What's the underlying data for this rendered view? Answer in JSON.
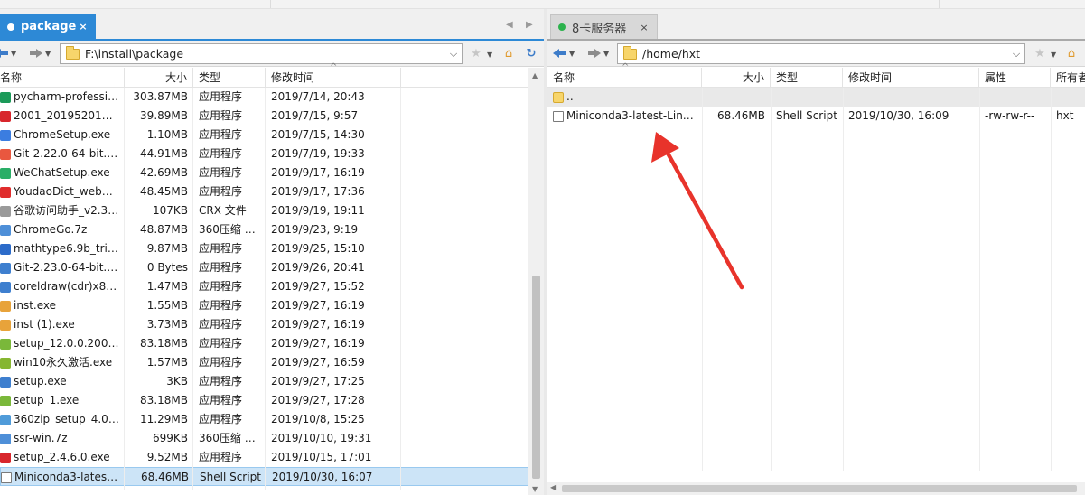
{
  "left_pane": {
    "tab": {
      "label": "package",
      "close": "×"
    },
    "address": {
      "path": "F:\\install\\package",
      "dropdown": "⌵"
    },
    "columns": [
      "名称",
      "大小",
      "类型",
      "修改时间"
    ],
    "files": [
      {
        "name": "pycharm-professio...",
        "size": "303.87MB",
        "type": "应用程序",
        "modified": "2019/7/14, 20:43",
        "icon": "pycharm-icon",
        "color": "#1b9a59"
      },
      {
        "name": "2001_20195201930...",
        "size": "39.89MB",
        "type": "应用程序",
        "modified": "2019/7/15, 9:57",
        "icon": "app-icon",
        "color": "#d8262c"
      },
      {
        "name": "ChromeSetup.exe",
        "size": "1.10MB",
        "type": "应用程序",
        "modified": "2019/7/15, 14:30",
        "icon": "chrome-icon",
        "color": "#3b7de0"
      },
      {
        "name": "Git-2.22.0-64-bit.exe",
        "size": "44.91MB",
        "type": "应用程序",
        "modified": "2019/7/19, 19:33",
        "icon": "git-icon",
        "color": "#e9573f"
      },
      {
        "name": "WeChatSetup.exe",
        "size": "42.69MB",
        "type": "应用程序",
        "modified": "2019/9/17, 16:19",
        "icon": "wechat-icon",
        "color": "#2aae67"
      },
      {
        "name": "YoudaoDict_webdic...",
        "size": "48.45MB",
        "type": "应用程序",
        "modified": "2019/9/17, 17:36",
        "icon": "youdao-icon",
        "color": "#e02d2d"
      },
      {
        "name": "谷歌访问助手_v2.3.0....",
        "size": "107KB",
        "type": "CRX 文件",
        "modified": "2019/9/19, 19:11",
        "icon": "file-icon",
        "color": "#9a9a9a"
      },
      {
        "name": "ChromeGo.7z",
        "size": "48.87MB",
        "type": "360压缩 7...",
        "modified": "2019/9/23, 9:19",
        "icon": "archive-icon",
        "color": "#4e8fd8"
      },
      {
        "name": "mathtype6.9b_trial....",
        "size": "9.87MB",
        "type": "应用程序",
        "modified": "2019/9/25, 15:10",
        "icon": "mathtype-icon",
        "color": "#2c6bc9"
      },
      {
        "name": "Git-2.23.0-64-bit.exe",
        "size": "0 Bytes",
        "type": "应用程序",
        "modified": "2019/9/26, 20:41",
        "icon": "exe-icon",
        "color": "#3e7fcf"
      },
      {
        "name": "coreldraw(cdr)x8破...",
        "size": "1.47MB",
        "type": "应用程序",
        "modified": "2019/9/27, 15:52",
        "icon": "exe-icon",
        "color": "#3e7fcf"
      },
      {
        "name": "inst.exe",
        "size": "1.55MB",
        "type": "应用程序",
        "modified": "2019/9/27, 16:19",
        "icon": "installer-icon",
        "color": "#e8a33a"
      },
      {
        "name": "inst (1).exe",
        "size": "3.73MB",
        "type": "应用程序",
        "modified": "2019/9/27, 16:19",
        "icon": "installer-icon",
        "color": "#e8a33a"
      },
      {
        "name": "setup_12.0.0.2001o....",
        "size": "83.18MB",
        "type": "应用程序",
        "modified": "2019/9/27, 16:19",
        "icon": "setup-icon",
        "color": "#7ab83a"
      },
      {
        "name": "win10永久激活.exe",
        "size": "1.57MB",
        "type": "应用程序",
        "modified": "2019/9/27, 16:59",
        "icon": "activator-icon",
        "color": "#86b631"
      },
      {
        "name": "setup.exe",
        "size": "3KB",
        "type": "应用程序",
        "modified": "2019/9/27, 17:25",
        "icon": "exe-icon",
        "color": "#3e7fcf"
      },
      {
        "name": "setup_1.exe",
        "size": "83.18MB",
        "type": "应用程序",
        "modified": "2019/9/27, 17:28",
        "icon": "setup-icon",
        "color": "#7ab83a"
      },
      {
        "name": "360zip_setup_4.0.0....",
        "size": "11.29MB",
        "type": "应用程序",
        "modified": "2019/10/8, 15:25",
        "icon": "zip-icon",
        "color": "#4f9bd9"
      },
      {
        "name": "ssr-win.7z",
        "size": "699KB",
        "type": "360压缩 7...",
        "modified": "2019/10/10, 19:31",
        "icon": "archive-icon",
        "color": "#4e8fd8"
      },
      {
        "name": "setup_2.4.6.0.exe",
        "size": "9.52MB",
        "type": "应用程序",
        "modified": "2019/10/15, 17:01",
        "icon": "app-icon",
        "color": "#d8262c"
      },
      {
        "name": "Miniconda3-latest-L...",
        "size": "68.46MB",
        "type": "Shell Script",
        "modified": "2019/10/30, 16:07",
        "icon": "shell-script-icon",
        "color": "#7a7a7a",
        "selected": true
      }
    ]
  },
  "right_pane": {
    "tab": {
      "label": "8卡服务器",
      "close": "×",
      "status_color": "#2bb24c"
    },
    "address": {
      "path": "/home/hxt",
      "dropdown": "⌵"
    },
    "columns": [
      "名称",
      "大小",
      "类型",
      "修改时间",
      "属性",
      "所有者"
    ],
    "parent_row": "..",
    "files": [
      {
        "name": "Miniconda3-latest-Linu...",
        "size": "68.46MB",
        "type": "Shell Script",
        "modified": "2019/10/30, 16:09",
        "attrs": "-rw-rw-r--",
        "owner": "hxt"
      }
    ]
  },
  "colors": {
    "accent": "#2d89d6",
    "selection": "#cce4f7",
    "annotation": "#e8332b"
  }
}
